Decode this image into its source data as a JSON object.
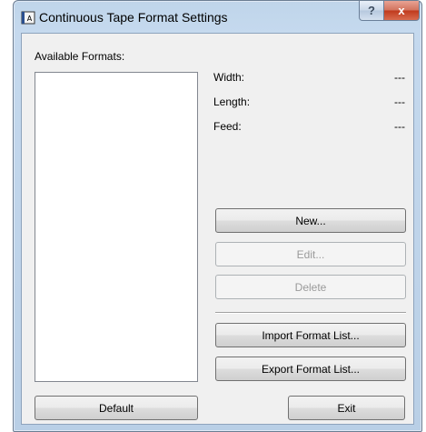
{
  "window": {
    "title": "Continuous Tape Format Settings",
    "help_label": "?",
    "close_label": "x"
  },
  "available_formats_label": "Available Formats:",
  "available_formats_items": [],
  "properties": {
    "width_label": "Width:",
    "width_value": "---",
    "length_label": "Length:",
    "length_value": "---",
    "feed_label": "Feed:",
    "feed_value": "---"
  },
  "buttons": {
    "new": "New...",
    "edit": "Edit...",
    "delete": "Delete",
    "import": "Import Format List...",
    "export": "Export Format List...",
    "default": "Default",
    "exit": "Exit"
  },
  "colors": {
    "titlebar": "#bfd5ea",
    "close_button": "#c0391c",
    "dialog_background": "#f0f0f0"
  }
}
